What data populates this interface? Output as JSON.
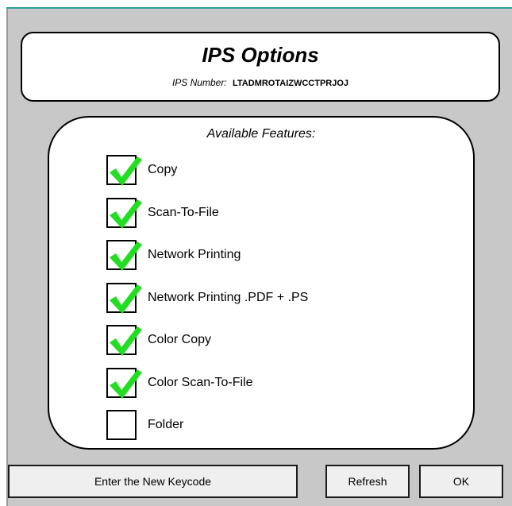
{
  "dialog": {
    "title": "IPS Options",
    "ips_number_label": "IPS Number:",
    "ips_number_value": "LTADMROTAIZWCCTPRJOJ"
  },
  "features": {
    "header": "Available Features:",
    "items": [
      {
        "label": "Copy",
        "checked": true
      },
      {
        "label": "Scan-To-File",
        "checked": true
      },
      {
        "label": "Network Printing",
        "checked": true
      },
      {
        "label": "Network Printing .PDF + .PS",
        "checked": true
      },
      {
        "label": "Color Copy",
        "checked": true
      },
      {
        "label": "Color Scan-To-File",
        "checked": true
      },
      {
        "label": "Folder",
        "checked": false
      }
    ]
  },
  "buttons": {
    "enter_keycode": "Enter the New Keycode",
    "refresh": "Refresh",
    "ok": "OK"
  },
  "colors": {
    "check_mark": "#22dd22",
    "accent": "#2aa198",
    "background": "#c8c8c8"
  },
  "icons": {
    "checked": "green-check-icon"
  }
}
